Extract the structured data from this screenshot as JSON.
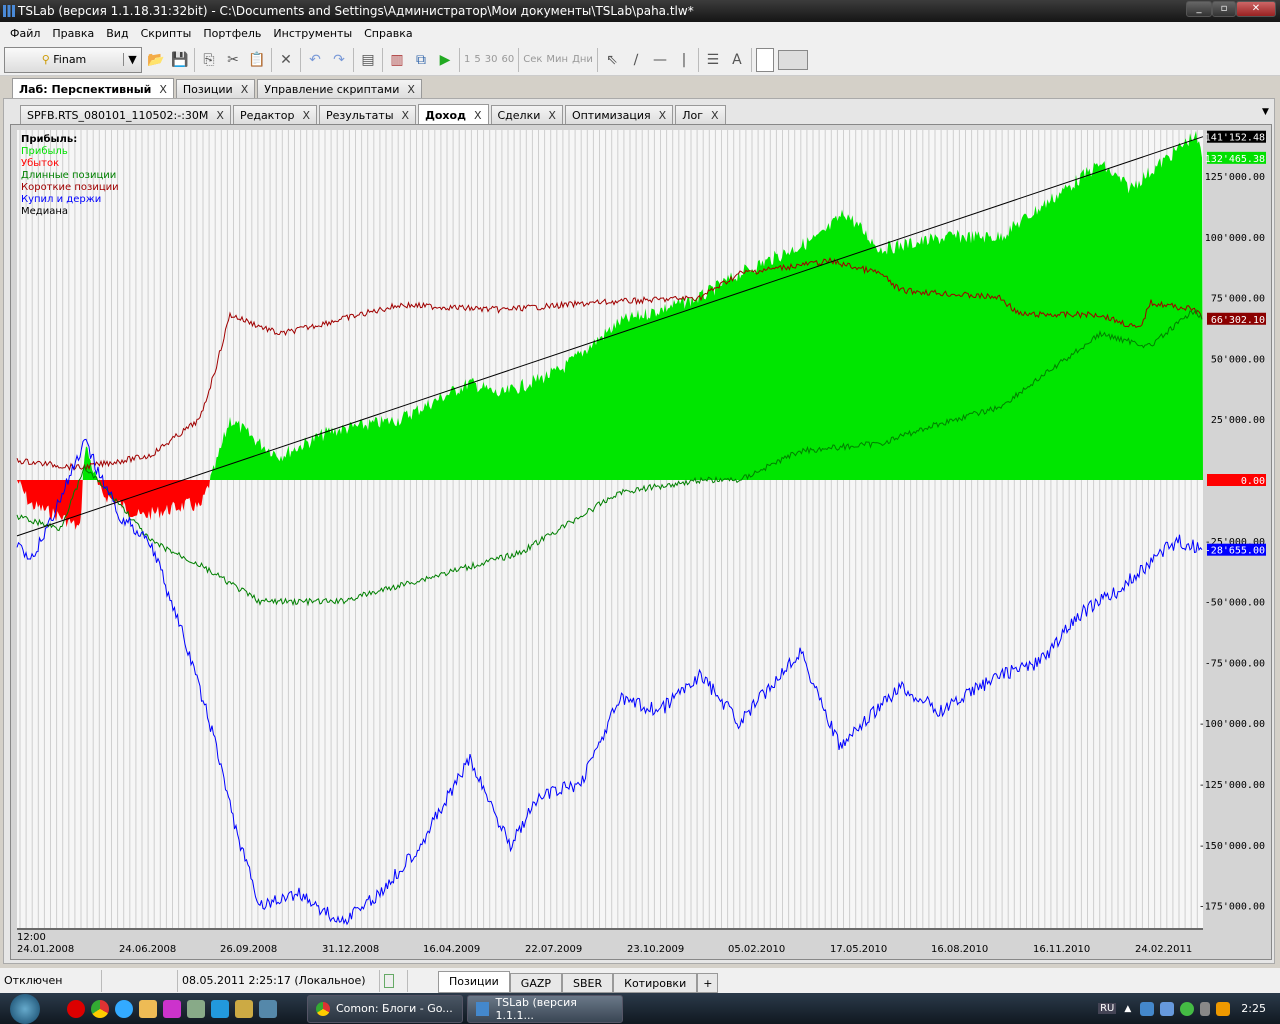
{
  "window": {
    "title": "TSLab (версия 1.1.18.31:32bit) - C:\\Documents and Settings\\Администратор\\Мои документы\\TSLab\\paha.tlw*"
  },
  "menu": [
    "Файл",
    "Правка",
    "Вид",
    "Скрипты",
    "Портфель",
    "Инструменты",
    "Справка"
  ],
  "toolbar": {
    "connection": "Finam",
    "intervals": [
      "1",
      "5",
      "30",
      "60"
    ],
    "units": [
      "Сек",
      "Мин",
      "Дни"
    ]
  },
  "outer_tabs": [
    {
      "label": "Лаб: Перспективный",
      "active": true
    },
    {
      "label": "Позиции"
    },
    {
      "label": "Управление скриптами"
    }
  ],
  "inner_tabs": [
    {
      "label": "SPFB.RTS_080101_110502:-:30M"
    },
    {
      "label": "Редактор"
    },
    {
      "label": "Результаты"
    },
    {
      "label": "Доход",
      "active": true
    },
    {
      "label": "Сделки"
    },
    {
      "label": "Оптимизация"
    },
    {
      "label": "Лог"
    }
  ],
  "tab_close": "X",
  "legend": {
    "title": "Прибыль:",
    "items": [
      {
        "label": "Прибыль",
        "color": "#00e000"
      },
      {
        "label": "Убыток",
        "color": "#ff0000"
      },
      {
        "label": "Длинные позиции",
        "color": "#008000"
      },
      {
        "label": "Короткие позиции",
        "color": "#a00000"
      },
      {
        "label": "Купил и держи",
        "color": "#0000ff"
      },
      {
        "label": "Медиана",
        "color": "#000000"
      }
    ]
  },
  "chart_data": {
    "type": "line",
    "title": "Прибыль",
    "x_unit": "bar index",
    "xlim": [
      0,
      1186
    ],
    "ylim": [
      -185000,
      145000
    ],
    "x_ticks": [
      {
        "x": 0,
        "label": "24.01.2008",
        "sub": "12:00"
      },
      {
        "x": 102,
        "label": "24.06.2008"
      },
      {
        "x": 203,
        "label": "26.09.2008"
      },
      {
        "x": 305,
        "label": "31.12.2008"
      },
      {
        "x": 406,
        "label": "16.04.2009"
      },
      {
        "x": 508,
        "label": "22.07.2009"
      },
      {
        "x": 610,
        "label": "23.10.2009"
      },
      {
        "x": 711,
        "label": "05.02.2010"
      },
      {
        "x": 813,
        "label": "17.05.2010"
      },
      {
        "x": 914,
        "label": "16.08.2010"
      },
      {
        "x": 1016,
        "label": "16.11.2010"
      },
      {
        "x": 1118,
        "label": "24.02.2011"
      }
    ],
    "y_ticks": [
      125000,
      100000,
      75000,
      50000,
      25000,
      -25000,
      -50000,
      -75000,
      -100000,
      -125000,
      -150000,
      -175000
    ],
    "y_tick_labels": [
      "125'000.00",
      "100'000.00",
      "75'000.00",
      "50'000.00",
      "25'000.00",
      "-25'000.00",
      "-50'000.00",
      "-75'000.00",
      "-100'000.00",
      "-125'000.00",
      "-150'000.00",
      "-175'000.00"
    ],
    "last_values": [
      {
        "label": "141'152.48",
        "value": 141152.48,
        "color": "#000000"
      },
      {
        "label": "132'465.38",
        "value": 132465.38,
        "color": "#00e000"
      },
      {
        "label": "66'302.10",
        "value": 66302.1,
        "color": "#8b0000"
      },
      {
        "label": "0.00",
        "value": 0,
        "color": "#ff0000"
      },
      {
        "label": "-28'655.00",
        "value": -28655,
        "color": "#0000ff"
      }
    ],
    "series": [
      {
        "name": "Прибыль",
        "kind": "area",
        "x": [
          0,
          13,
          43,
          63,
          68,
          83,
          123,
          173,
          183,
          198,
          213,
          243,
          263,
          313,
          383,
          453,
          483,
          543,
          603,
          683,
          723,
          803,
          828,
          863,
          933,
          983,
          1033,
          1083,
          1113,
          1143,
          1178,
          1186
        ],
        "values": [
          0,
          -10000,
          -15000,
          -20000,
          15000,
          -5000,
          -15000,
          -10000,
          -12000,
          5000,
          25000,
          15000,
          10000,
          20000,
          25000,
          40000,
          35000,
          45000,
          65000,
          75000,
          85000,
          100000,
          110000,
          95000,
          100000,
          100000,
          115000,
          130000,
          120000,
          130000,
          142000,
          132465
        ]
      },
      {
        "name": "Короткие позиции",
        "color": "#a00000",
        "x": [
          0,
          63,
          133,
          183,
          198,
          213,
          263,
          313,
          383,
          483,
          583,
          683,
          723,
          813,
          863,
          883,
          983,
          1003,
          1083,
          1123,
          1133,
          1178,
          1186
        ],
        "values": [
          8000,
          5000,
          10000,
          25000,
          45000,
          68000,
          60000,
          65000,
          72000,
          70000,
          73000,
          75000,
          85000,
          90000,
          85000,
          78000,
          75000,
          68000,
          68000,
          62000,
          73000,
          70000,
          66302
        ]
      },
      {
        "name": "Длинные позиции",
        "color": "#008000",
        "x": [
          0,
          43,
          68,
          103,
          133,
          183,
          243,
          323,
          413,
          503,
          603,
          683,
          723,
          783,
          863,
          913,
          983,
          1033,
          1083,
          1133,
          1178,
          1186
        ],
        "values": [
          -15000,
          -20000,
          5000,
          -10000,
          -25000,
          -35000,
          -50000,
          -50000,
          -40000,
          -30000,
          -5000,
          0,
          0,
          12000,
          15000,
          22000,
          30000,
          45000,
          60000,
          55000,
          70000,
          66000
        ]
      },
      {
        "name": "Купил и держи",
        "color": "#0000ff",
        "x": [
          0,
          13,
          68,
          103,
          133,
          163,
          193,
          223,
          243,
          283,
          323,
          363,
          403,
          453,
          493,
          523,
          563,
          603,
          643,
          683,
          723,
          783,
          823,
          883,
          923,
          983,
          1023,
          1063,
          1103,
          1143,
          1163,
          1186
        ],
        "values": [
          -25000,
          -35000,
          15000,
          -15000,
          -25000,
          -60000,
          -100000,
          -150000,
          -175000,
          -170000,
          -182000,
          -170000,
          -150000,
          -115000,
          -150000,
          -130000,
          -125000,
          -90000,
          -95000,
          -80000,
          -100000,
          -70000,
          -110000,
          -85000,
          -95000,
          -80000,
          -75000,
          -55000,
          -45000,
          -30000,
          -25000,
          -28655
        ]
      },
      {
        "name": "Медиана",
        "color": "#000000",
        "x": [
          0,
          1186
        ],
        "values": [
          -23000,
          141152.48
        ]
      }
    ]
  },
  "status": {
    "connection": "Отключен",
    "time": "08.05.2011 2:25:17 (Локальное)",
    "tabs": [
      "Позиции",
      "GAZP",
      "SBER",
      "Котировки",
      "+"
    ]
  },
  "taskbar": {
    "tasks": [
      "Comon: Блоги - Go...",
      "TSLab (версия 1.1.1..."
    ],
    "lang": "RU",
    "clock": "2:25"
  }
}
